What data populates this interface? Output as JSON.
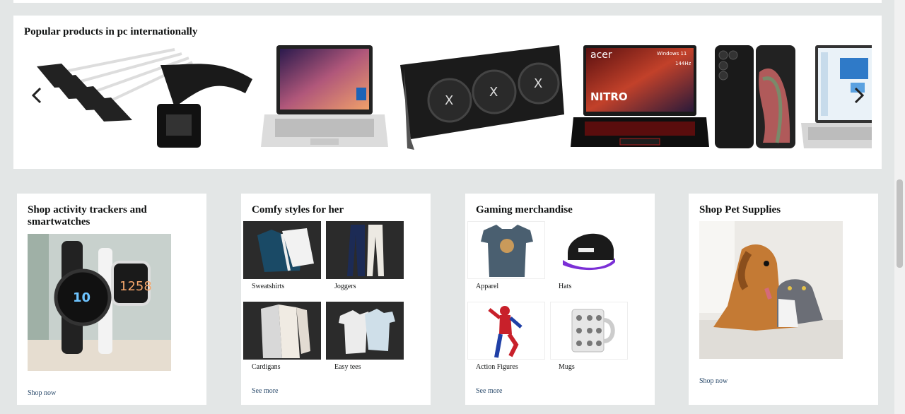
{
  "carousel": {
    "title": "Popular products in pc internationally",
    "products": [
      {
        "name": "sata-cable-icon"
      },
      {
        "name": "hp-laptop-icon"
      },
      {
        "name": "graphics-card-icon"
      },
      {
        "name": "acer-nitro-laptop-icon",
        "brand": "acer",
        "model": "NITRO",
        "os": "Windows 11",
        "refresh": "144Hz"
      },
      {
        "name": "samsung-phone-icon"
      },
      {
        "name": "laptop-partial-icon"
      }
    ]
  },
  "cards": [
    {
      "title": "Shop activity trackers and smartwatches",
      "link": "Shop now",
      "watch_time": "10",
      "watch_time2": "1258"
    },
    {
      "title": "Comfy styles for her",
      "link": "See more",
      "tiles": [
        "Sweatshirts",
        "Joggers",
        "Cardigans",
        "Easy tees"
      ]
    },
    {
      "title": "Gaming merchandise",
      "link": "See more",
      "tiles": [
        "Apparel",
        "Hats",
        "Action Figures",
        "Mugs"
      ]
    },
    {
      "title": "Shop Pet Supplies",
      "link": "Shop now"
    }
  ],
  "colors": {
    "page_bg": "#e3e6e6",
    "link": "#2a4a6b",
    "tile_bg": "#2b2b2b"
  }
}
